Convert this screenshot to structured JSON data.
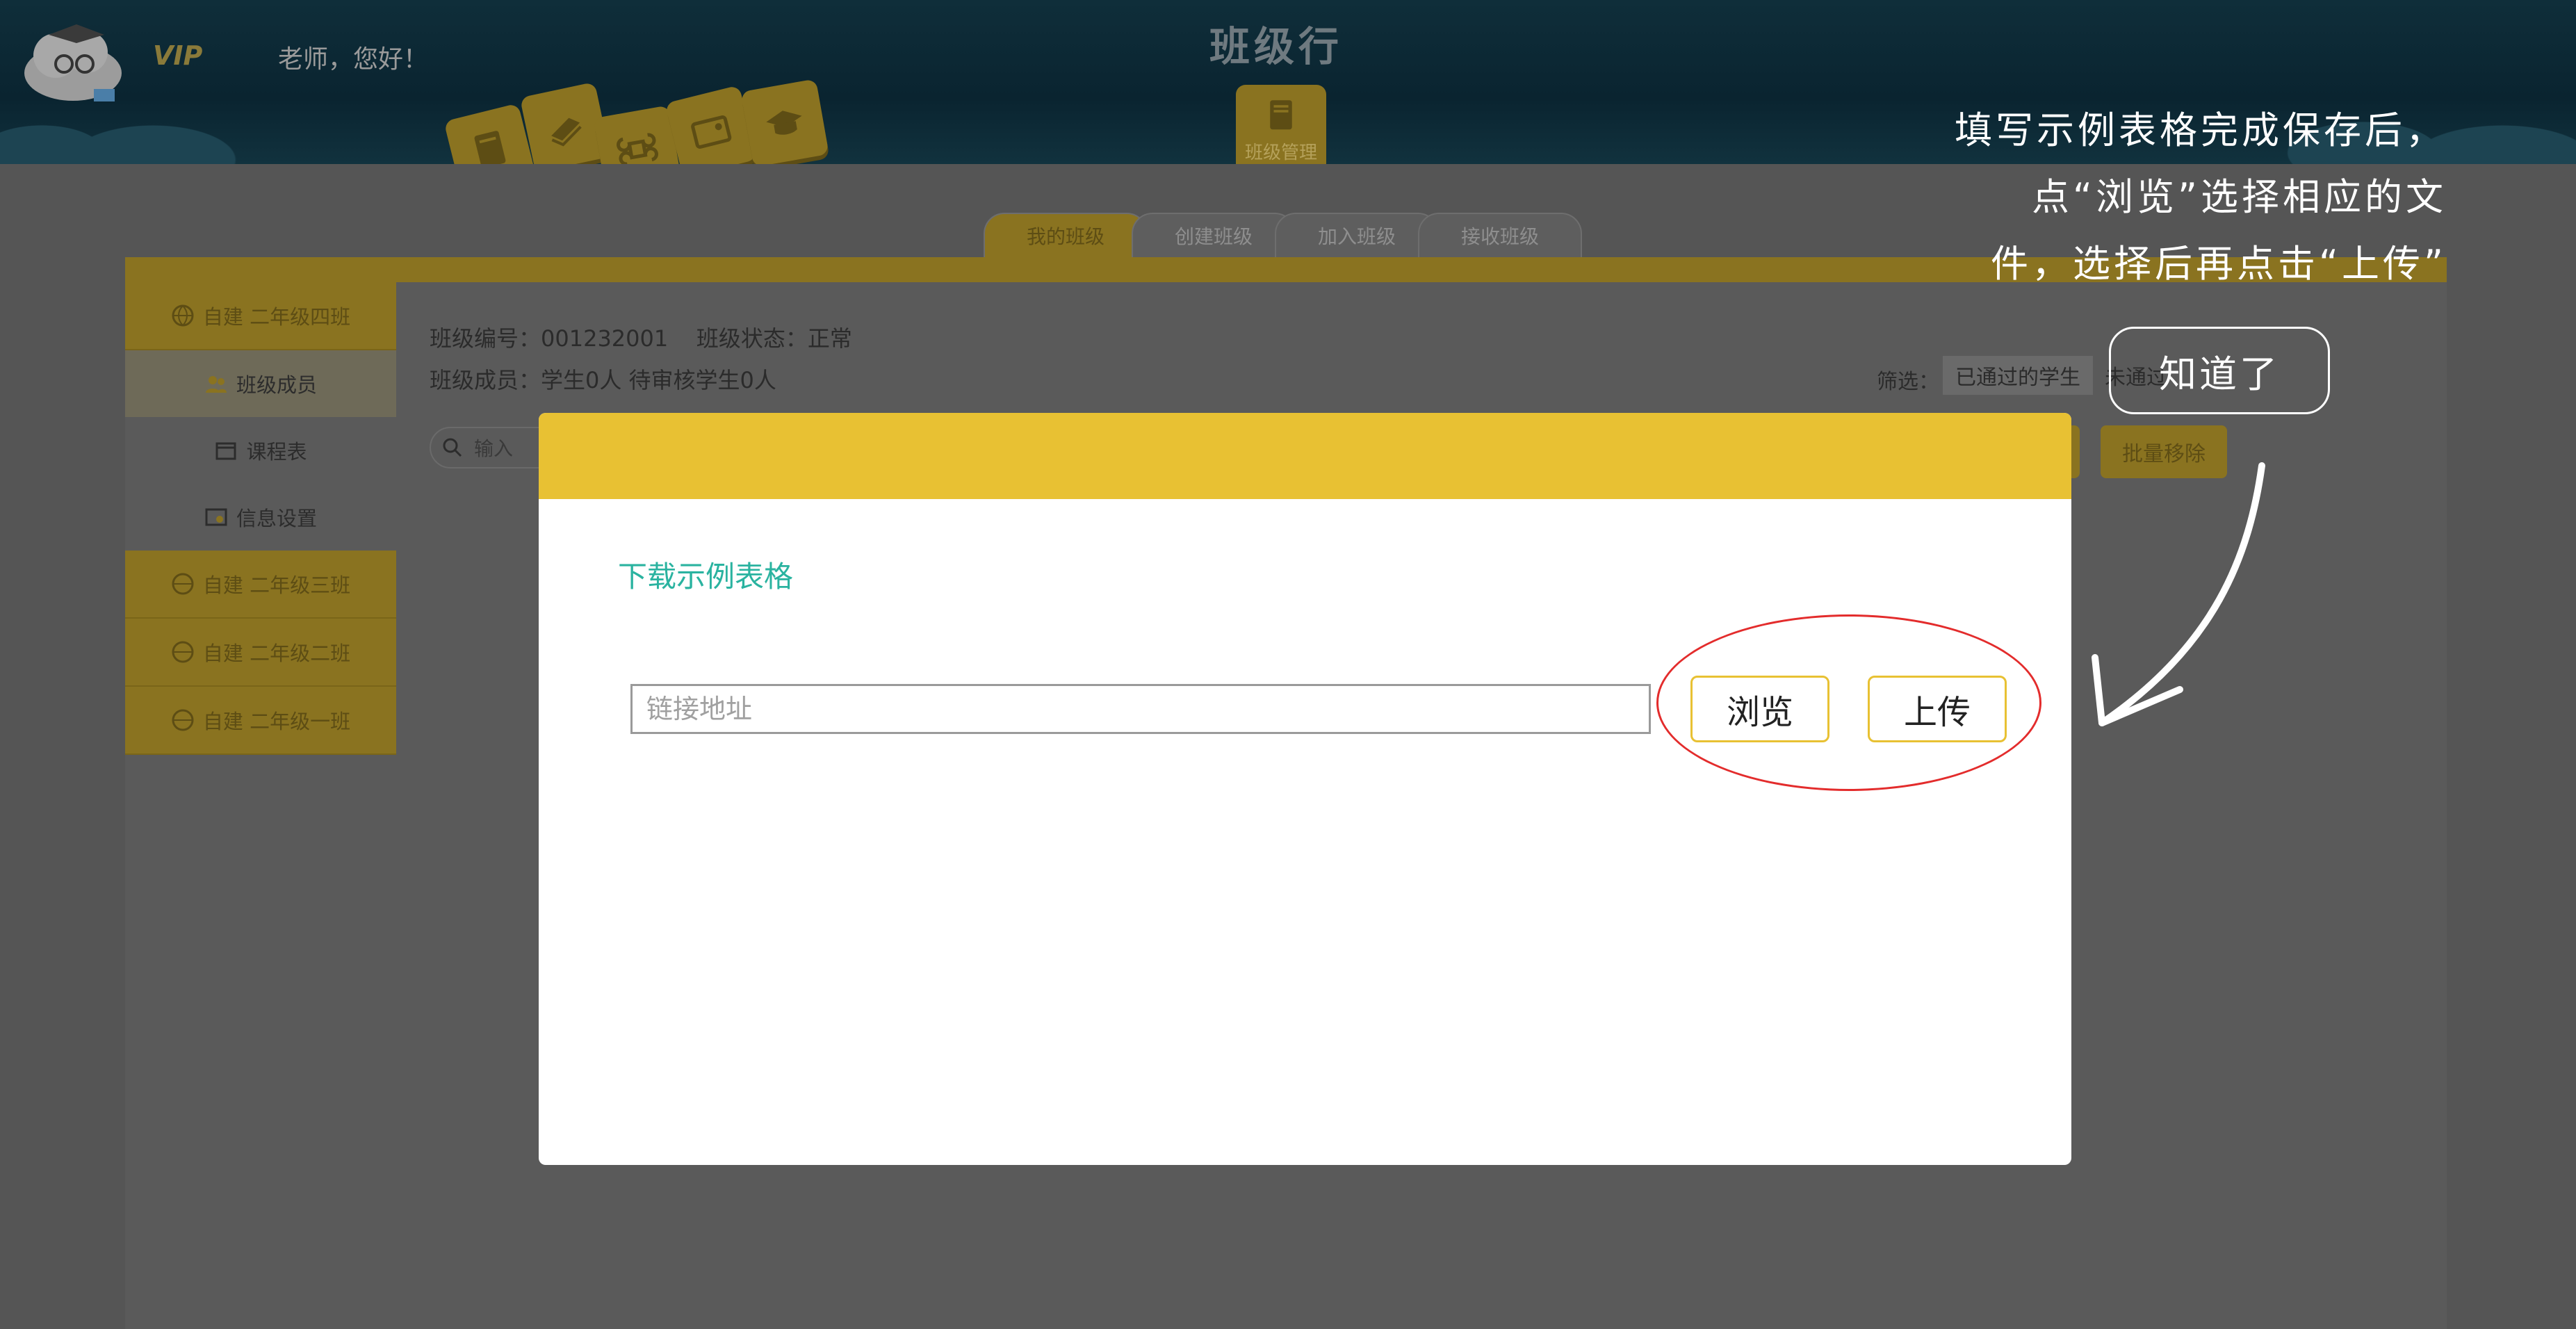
{
  "header": {
    "vip": "VIP",
    "greeting": "老师，您好！",
    "app_title": "班级行",
    "manage_tile_label": "班级管理"
  },
  "tabs": [
    {
      "label": "我的班级",
      "active": true
    },
    {
      "label": "创建班级",
      "active": false
    },
    {
      "label": "加入班级",
      "active": false
    },
    {
      "label": "接收班级",
      "active": false
    }
  ],
  "sidebar": {
    "items": [
      {
        "label": "自建 二年级四班",
        "type": "class"
      },
      {
        "label": "班级成员",
        "type": "sub",
        "selected": true
      },
      {
        "label": "课程表",
        "type": "sub"
      },
      {
        "label": "信息设置",
        "type": "sub"
      },
      {
        "label": "自建 二年级三班",
        "type": "class"
      },
      {
        "label": "自建 二年级二班",
        "type": "class"
      },
      {
        "label": "自建 二年级一班",
        "type": "class"
      }
    ]
  },
  "class_info": {
    "line1": "班级编号：001232001    班级状态：正常",
    "line2": "班级成员：学生0人 待审核学生0人"
  },
  "filter": {
    "label": "筛选：",
    "passed": "已通过的学生",
    "not_passed": "未通过"
  },
  "search": {
    "placeholder": "输入"
  },
  "buttons": {
    "batch_remove": "批量移除"
  },
  "modal": {
    "download_link": "下载示例表格",
    "input_placeholder": "链接地址",
    "browse_label": "浏览",
    "upload_label": "上传"
  },
  "tip": {
    "line1": "填写示例表格完成保存后，",
    "line2": "点“浏览”选择相应的文",
    "line3": "件，选择后再点击“上传”",
    "got_it": "知道了"
  },
  "colors": {
    "header_bg": "#0a2430",
    "accent_yellow": "#e8c133",
    "link_teal": "#2ab3a0",
    "highlight_red": "#e32c2c",
    "overlay_gray": "#555555"
  }
}
